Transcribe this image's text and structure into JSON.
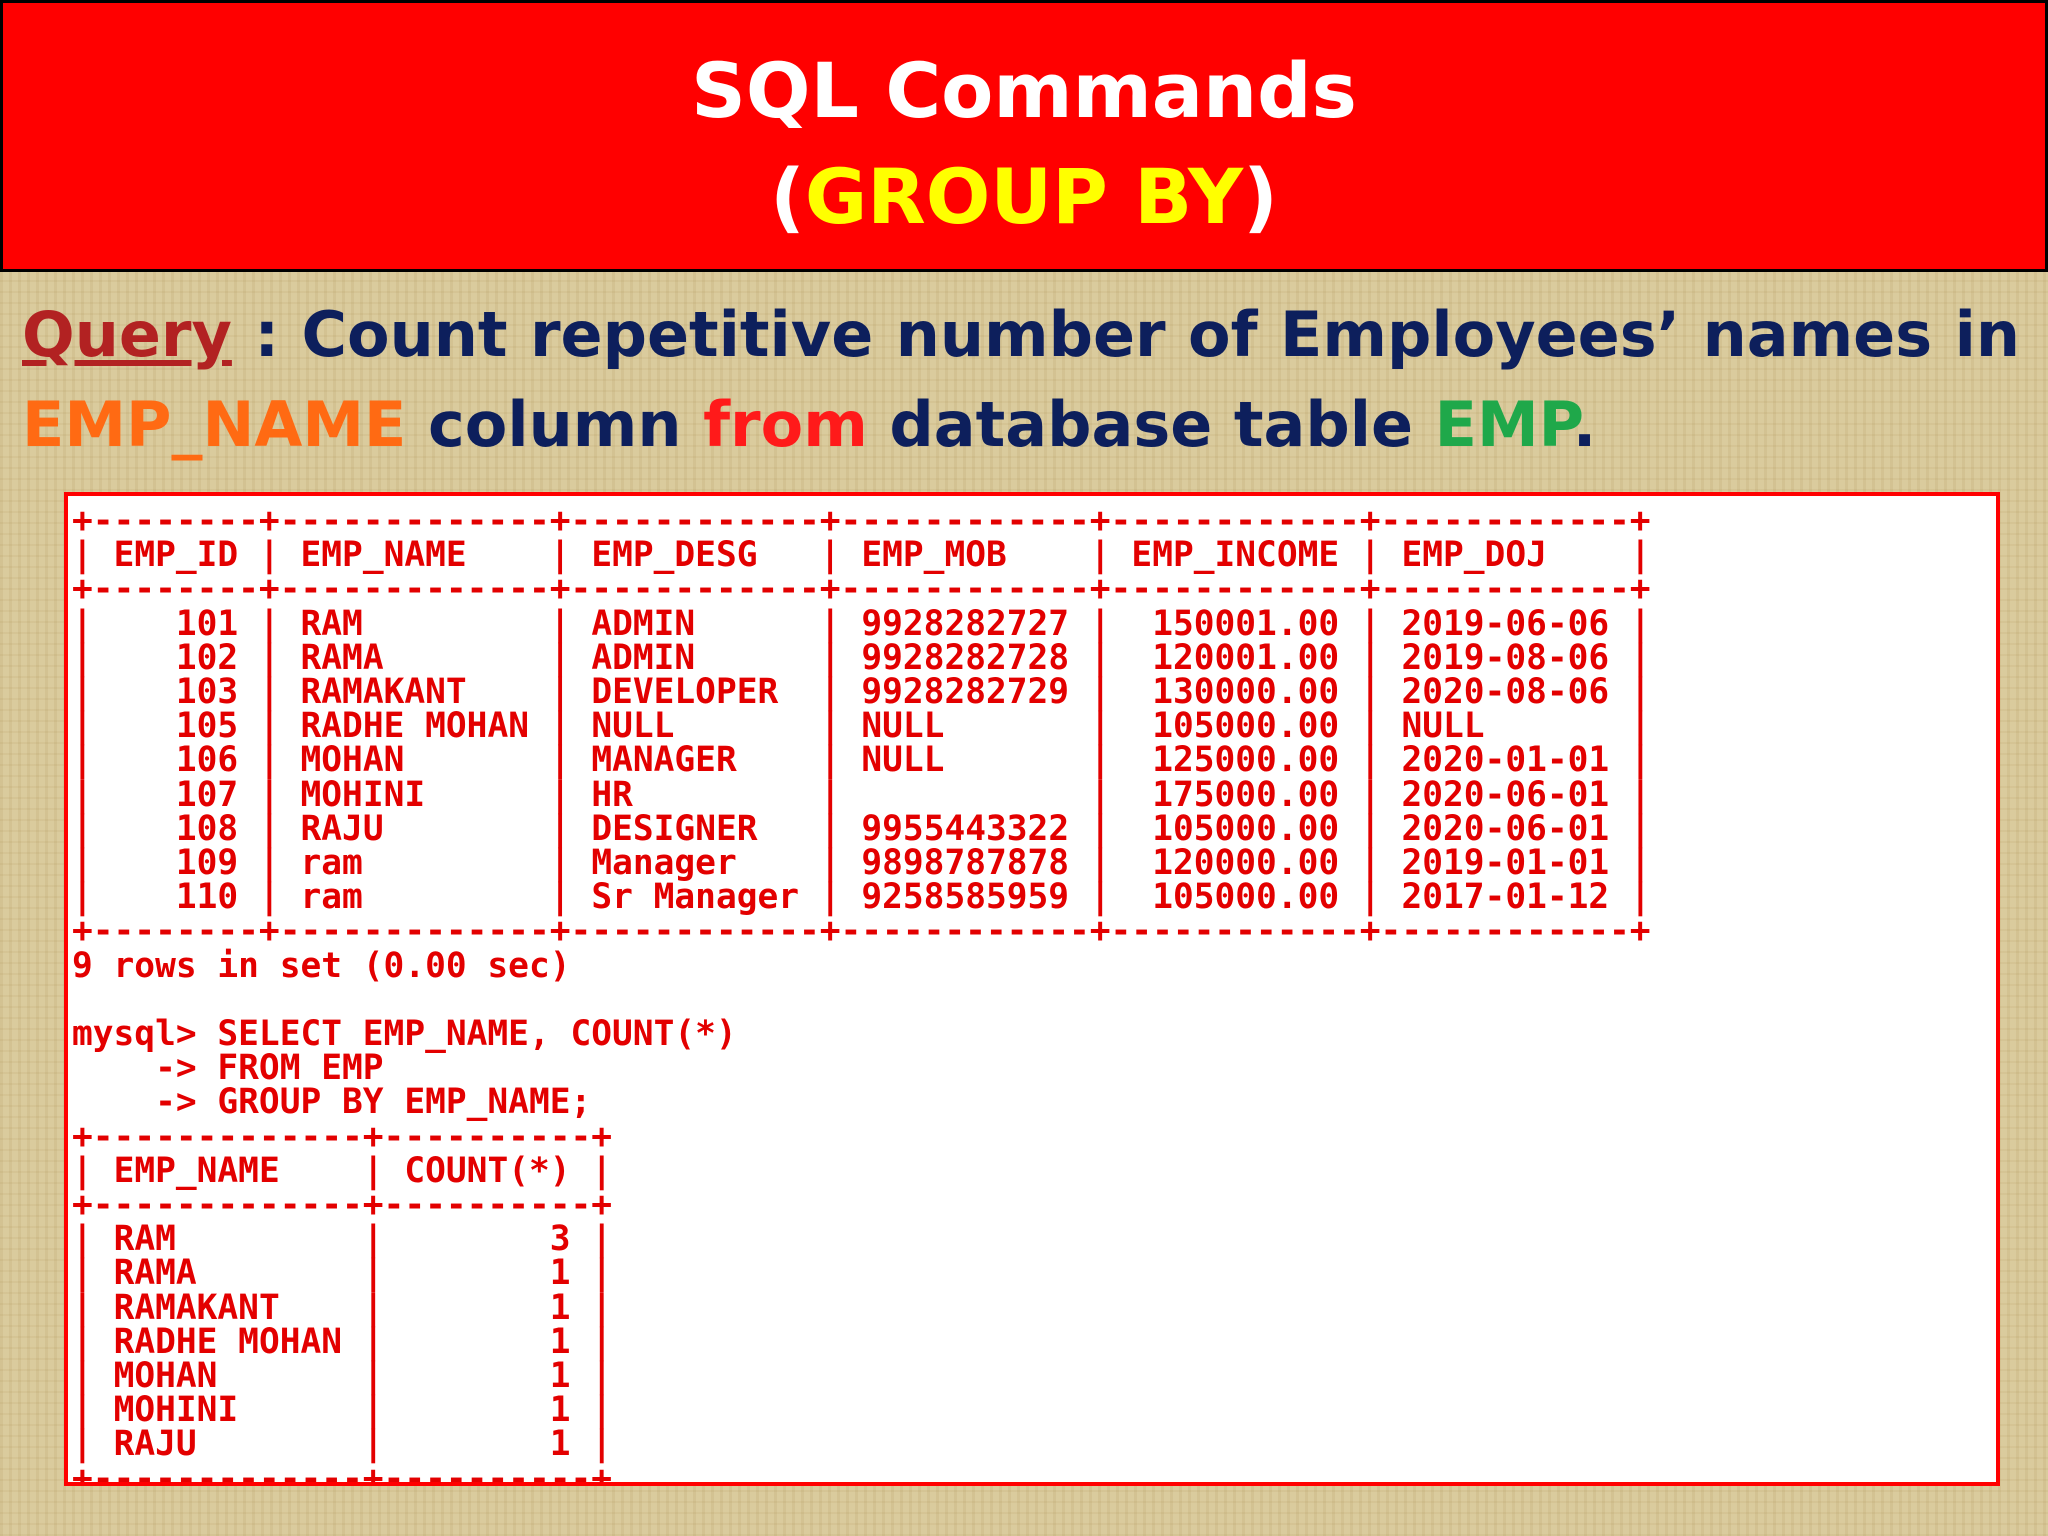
{
  "header": {
    "title": "SQL Commands",
    "subtitle_open": "(",
    "subtitle_keyword": "GROUP BY",
    "subtitle_close": ")"
  },
  "query": {
    "label": "Query",
    "colon": ":",
    "words_line1": [
      "Count",
      "repetitive",
      "number",
      "of",
      "Employees’",
      "names",
      "in"
    ],
    "column_name": "EMP_NAME",
    "text_column": " column ",
    "text_from": "from",
    "text_table": " database table ",
    "table_name": "EMP",
    "period": "."
  },
  "emp_table": {
    "columns": [
      "EMP_ID",
      "EMP_NAME",
      "EMP_DESG",
      "EMP_MOB",
      "EMP_INCOME",
      "EMP_DOJ"
    ],
    "rows": [
      [
        "101",
        "RAM",
        "ADMIN",
        "9928282727",
        "150001.00",
        "2019-06-06"
      ],
      [
        "102",
        "RAMA",
        "ADMIN",
        "9928282728",
        "120001.00",
        "2019-08-06"
      ],
      [
        "103",
        "RAMAKANT",
        "DEVELOPER",
        "9928282729",
        "130000.00",
        "2020-08-06"
      ],
      [
        "105",
        "RADHE MOHAN",
        "NULL",
        "NULL",
        "105000.00",
        "NULL"
      ],
      [
        "106",
        "MOHAN",
        "MANAGER",
        "NULL",
        "125000.00",
        "2020-01-01"
      ],
      [
        "107",
        "MOHINI",
        "HR",
        "",
        "175000.00",
        "2020-06-01"
      ],
      [
        "108",
        "RAJU",
        "DESIGNER",
        "9955443322",
        "105000.00",
        "2020-06-01"
      ],
      [
        "109",
        "ram",
        "Manager",
        "9898787878",
        "120000.00",
        "2019-01-01"
      ],
      [
        "110",
        "ram",
        "Sr Manager",
        "9258585959",
        "105000.00",
        "2017-01-12"
      ]
    ],
    "summary": "9 rows in set (0.00 sec)"
  },
  "sql_command": {
    "line1": "mysql> SELECT EMP_NAME, COUNT(*)",
    "line2": "    -> FROM EMP",
    "line3": "    -> GROUP BY EMP_NAME;"
  },
  "group_result": {
    "columns": [
      "EMP_NAME",
      "COUNT(*)"
    ],
    "rows": [
      [
        "RAM",
        "3"
      ],
      [
        "RAMA",
        "1"
      ],
      [
        "RAMAKANT",
        "1"
      ],
      [
        "RADHE MOHAN",
        "1"
      ],
      [
        "MOHAN",
        "1"
      ],
      [
        "MOHINI",
        "1"
      ],
      [
        "RAJU",
        "1"
      ]
    ]
  },
  "colors": {
    "header_bg": "#ff0000",
    "header_keyword": "#ffff00",
    "query_text": "#0d1f5c",
    "column_highlight": "#ff6a13",
    "from_highlight": "#ff1a1a",
    "table_highlight": "#1fa84a",
    "terminal_text": "#e30000"
  }
}
